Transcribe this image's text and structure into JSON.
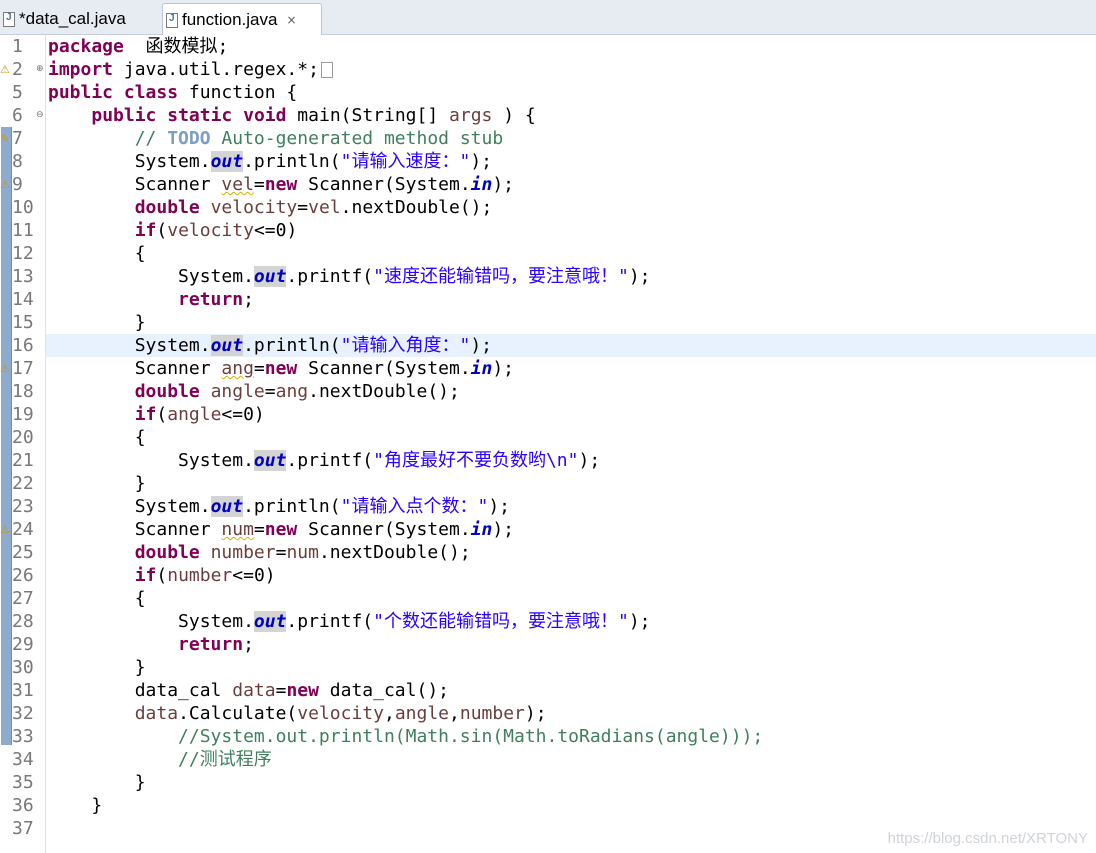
{
  "tabs": [
    {
      "label": "*data_cal.java",
      "active": false
    },
    {
      "label": "function.java",
      "active": true
    }
  ],
  "tab_close_glyph": "×",
  "watermark": "https://blog.csdn.net/XRTONY",
  "colors": {
    "keyword": "#7f0055",
    "field": "#0000c0",
    "string": "#2a00ff",
    "comment": "#3f7f5f",
    "current_line": "#e8f2fe"
  },
  "editor": {
    "lines": [
      {
        "num": "1",
        "tokens": [
          [
            "kw",
            "package"
          ],
          [
            "",
            "  函数模拟;"
          ]
        ]
      },
      {
        "num": "2",
        "fold": "+",
        "tokens": [
          [
            "kw",
            "import"
          ],
          [
            "",
            " java.util.regex.*;"
          ]
        ],
        "collapsed": true
      },
      {
        "num": "5",
        "tokens": [
          [
            "kw",
            "public"
          ],
          [
            "",
            " "
          ],
          [
            "kw",
            "class"
          ],
          [
            "",
            " function {"
          ]
        ]
      },
      {
        "num": "6",
        "fold": "-",
        "tokens": [
          [
            "",
            "    "
          ],
          [
            "kw",
            "public"
          ],
          [
            "",
            " "
          ],
          [
            "kw",
            "static"
          ],
          [
            "",
            " "
          ],
          [
            "kw",
            "void"
          ],
          [
            "",
            " main(String[] "
          ],
          [
            "var",
            "args"
          ],
          [
            "",
            " ) {"
          ]
        ]
      },
      {
        "num": "7",
        "tokens": [
          [
            "",
            "        "
          ],
          [
            "cm",
            "// "
          ],
          [
            "todo",
            "TODO"
          ],
          [
            "cm",
            " Auto-generated method stub"
          ]
        ]
      },
      {
        "num": "8",
        "tokens": [
          [
            "",
            "        System."
          ],
          [
            "fld occ",
            "out"
          ],
          [
            "",
            ".println("
          ],
          [
            "str",
            "\"请输入速度：\""
          ],
          [
            "",
            ");"
          ]
        ]
      },
      {
        "num": "9",
        "tokens": [
          [
            "",
            "        Scanner "
          ],
          [
            "var warn",
            "vel"
          ],
          [
            "",
            "="
          ],
          [
            "kw",
            "new"
          ],
          [
            "",
            " Scanner(System."
          ],
          [
            "fld",
            "in"
          ],
          [
            "",
            ");"
          ]
        ]
      },
      {
        "num": "10",
        "tokens": [
          [
            "",
            "        "
          ],
          [
            "kw",
            "double"
          ],
          [
            "",
            " "
          ],
          [
            "var",
            "velocity"
          ],
          [
            "",
            "="
          ],
          [
            "var",
            "vel"
          ],
          [
            "",
            ".nextDouble();"
          ]
        ]
      },
      {
        "num": "11",
        "tokens": [
          [
            "",
            "        "
          ],
          [
            "kw",
            "if"
          ],
          [
            "",
            "("
          ],
          [
            "var",
            "velocity"
          ],
          [
            "",
            "<=0)"
          ]
        ]
      },
      {
        "num": "12",
        "tokens": [
          [
            "",
            "        {"
          ]
        ]
      },
      {
        "num": "13",
        "tokens": [
          [
            "",
            "            System."
          ],
          [
            "fld occ",
            "out"
          ],
          [
            "",
            ".printf("
          ],
          [
            "str",
            "\"速度还能输错吗，要注意哦！\""
          ],
          [
            "",
            ");"
          ]
        ]
      },
      {
        "num": "14",
        "tokens": [
          [
            "",
            "            "
          ],
          [
            "kw",
            "return"
          ],
          [
            "",
            ";"
          ]
        ]
      },
      {
        "num": "15",
        "tokens": [
          [
            "",
            "        }"
          ]
        ]
      },
      {
        "num": "16",
        "current": true,
        "tokens": [
          [
            "",
            "        System."
          ],
          [
            "fld occ",
            "o"
          ],
          [
            "caret",
            ""
          ],
          [
            "fld occ",
            "ut"
          ],
          [
            "",
            ".println("
          ],
          [
            "str",
            "\"请输入角度：\""
          ],
          [
            "",
            ");"
          ]
        ]
      },
      {
        "num": "17",
        "tokens": [
          [
            "",
            "        Scanner "
          ],
          [
            "var warn",
            "ang"
          ],
          [
            "",
            "="
          ],
          [
            "kw",
            "new"
          ],
          [
            "",
            " Scanner(System."
          ],
          [
            "fld",
            "in"
          ],
          [
            "",
            ");"
          ]
        ]
      },
      {
        "num": "18",
        "tokens": [
          [
            "",
            "        "
          ],
          [
            "kw",
            "double"
          ],
          [
            "",
            " "
          ],
          [
            "var",
            "angle"
          ],
          [
            "",
            "="
          ],
          [
            "var",
            "ang"
          ],
          [
            "",
            ".nextDouble();"
          ]
        ]
      },
      {
        "num": "19",
        "tokens": [
          [
            "",
            "        "
          ],
          [
            "kw",
            "if"
          ],
          [
            "",
            "("
          ],
          [
            "var",
            "angle"
          ],
          [
            "",
            "<=0)"
          ]
        ]
      },
      {
        "num": "20",
        "tokens": [
          [
            "",
            "        {"
          ]
        ]
      },
      {
        "num": "21",
        "tokens": [
          [
            "",
            "            System."
          ],
          [
            "fld occ",
            "out"
          ],
          [
            "",
            ".printf("
          ],
          [
            "str",
            "\"角度最好不要负数哟\\n\""
          ],
          [
            "",
            ");"
          ]
        ]
      },
      {
        "num": "22",
        "tokens": [
          [
            "",
            "        }"
          ]
        ]
      },
      {
        "num": "23",
        "tokens": [
          [
            "",
            "        System."
          ],
          [
            "fld occ",
            "out"
          ],
          [
            "",
            ".println("
          ],
          [
            "str",
            "\"请输入点个数：\""
          ],
          [
            "",
            ");"
          ]
        ]
      },
      {
        "num": "24",
        "tokens": [
          [
            "",
            "        Scanner "
          ],
          [
            "var warn",
            "num"
          ],
          [
            "",
            "="
          ],
          [
            "kw",
            "new"
          ],
          [
            "",
            " Scanner(System."
          ],
          [
            "fld",
            "in"
          ],
          [
            "",
            ");"
          ]
        ]
      },
      {
        "num": "25",
        "tokens": [
          [
            "",
            "        "
          ],
          [
            "kw",
            "double"
          ],
          [
            "",
            " "
          ],
          [
            "var",
            "number"
          ],
          [
            "",
            "="
          ],
          [
            "var",
            "num"
          ],
          [
            "",
            ".nextDouble();"
          ]
        ]
      },
      {
        "num": "26",
        "tokens": [
          [
            "",
            "        "
          ],
          [
            "kw",
            "if"
          ],
          [
            "",
            "("
          ],
          [
            "var",
            "number"
          ],
          [
            "",
            "<=0)"
          ]
        ]
      },
      {
        "num": "27",
        "tokens": [
          [
            "",
            "        {"
          ]
        ]
      },
      {
        "num": "28",
        "tokens": [
          [
            "",
            "            System."
          ],
          [
            "fld occ",
            "out"
          ],
          [
            "",
            ".printf("
          ],
          [
            "str",
            "\"个数还能输错吗，要注意哦！\""
          ],
          [
            "",
            ");"
          ]
        ]
      },
      {
        "num": "29",
        "tokens": [
          [
            "",
            "            "
          ],
          [
            "kw",
            "return"
          ],
          [
            "",
            ";"
          ]
        ]
      },
      {
        "num": "30",
        "tokens": [
          [
            "",
            "        }"
          ]
        ]
      },
      {
        "num": "31",
        "tokens": [
          [
            "",
            "        data_cal "
          ],
          [
            "var",
            "data"
          ],
          [
            "",
            "="
          ],
          [
            "kw",
            "new"
          ],
          [
            "",
            " data_cal();"
          ]
        ]
      },
      {
        "num": "32",
        "tokens": [
          [
            "",
            "        "
          ],
          [
            "var",
            "data"
          ],
          [
            "",
            ".Calculate("
          ],
          [
            "var",
            "velocity"
          ],
          [
            "",
            ","
          ],
          [
            "var",
            "angle"
          ],
          [
            "",
            ","
          ],
          [
            "var",
            "number"
          ],
          [
            "",
            ");"
          ]
        ]
      },
      {
        "num": "33",
        "tokens": [
          [
            "",
            "            "
          ],
          [
            "cm",
            "//System.out.println(Math.sin(Math.toRadians(angle)));"
          ]
        ]
      },
      {
        "num": "34",
        "tokens": [
          [
            "",
            "            "
          ],
          [
            "cm",
            "//测试程序"
          ]
        ]
      },
      {
        "num": "35",
        "tokens": [
          [
            "",
            "        }"
          ]
        ]
      },
      {
        "num": "36",
        "tokens": [
          [
            "",
            "    }"
          ]
        ]
      },
      {
        "num": "37",
        "tokens": []
      }
    ],
    "markers": [
      {
        "line_index": 1,
        "icon": "warning-lightbulb-icon",
        "glyph": "⚠"
      },
      {
        "line_index": 4,
        "icon": "task-icon",
        "glyph": "✎"
      },
      {
        "line_index": 6,
        "icon": "warning-lightbulb-icon",
        "glyph": "⚠"
      },
      {
        "line_index": 14,
        "icon": "warning-lightbulb-icon",
        "glyph": "⚠"
      },
      {
        "line_index": 21,
        "icon": "warning-lightbulb-icon",
        "glyph": "⚠"
      }
    ]
  }
}
